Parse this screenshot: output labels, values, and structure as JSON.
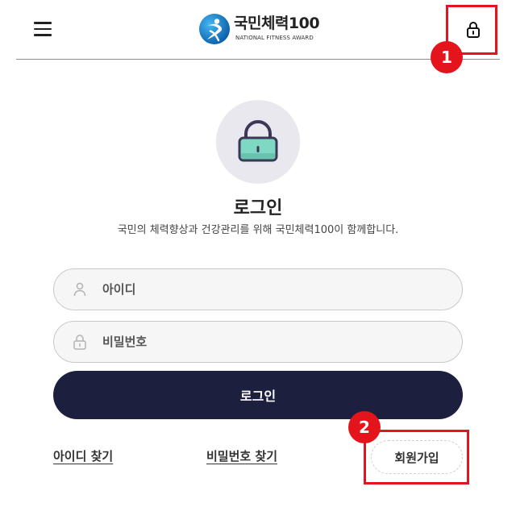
{
  "header": {
    "menu_icon": "hamburger-menu-icon",
    "logo": {
      "icon": "national-fitness-logo-icon",
      "title": "국민체력100",
      "subtitle": "NATIONAL FITNESS AWARD"
    },
    "login_icon": "lock-icon"
  },
  "login": {
    "icon": "padlock-icon",
    "title": "로그인",
    "subtitle": "국민의 체력향상과 건강관리를 위해 국민체력100이 함께합니다.",
    "id_field": {
      "icon": "user-icon",
      "placeholder": "아이디"
    },
    "password_field": {
      "icon": "lock-icon",
      "placeholder": "비밀번호"
    },
    "submit_label": "로그인"
  },
  "links": {
    "find_id": "아이디 찾기",
    "find_password": "비밀번호 찾기",
    "signup": "회원가입"
  },
  "annotations": [
    {
      "number": "1"
    },
    {
      "number": "2"
    }
  ],
  "colors": {
    "primary_button": "#1c1f3d",
    "annotation_red": "#e3141b",
    "padlock_body": "#7fd8c3",
    "padlock_outline": "#3c3756",
    "hero_circle": "#e8e8ee"
  }
}
